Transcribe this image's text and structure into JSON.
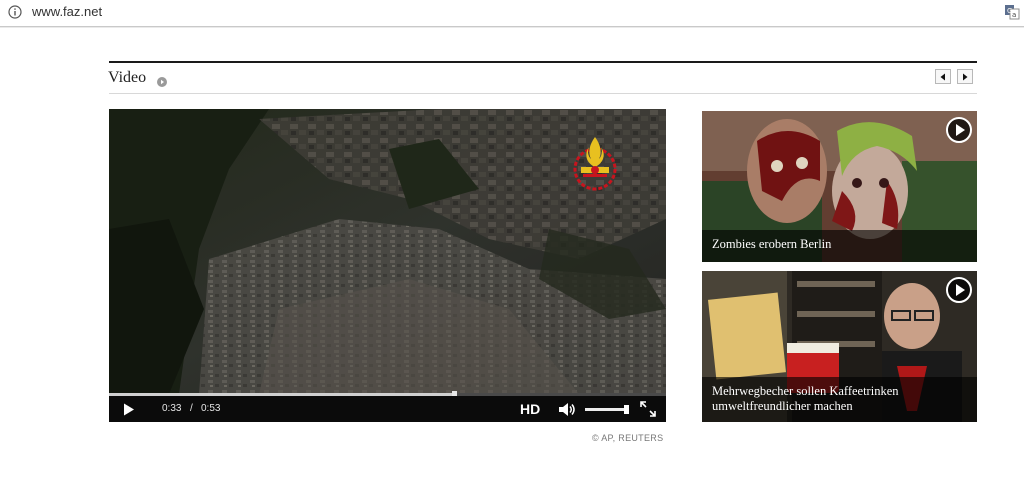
{
  "browser": {
    "url": "www.faz.net"
  },
  "section": {
    "title": "Video"
  },
  "main_video": {
    "current_time": "0:33",
    "time_separator": "/",
    "total_time": "0:53",
    "progress": 0.62,
    "hd_label": "HD",
    "volume": 1.0,
    "credit": "© AP, REUTERS"
  },
  "thumbnails": [
    {
      "caption": "Zombies erobern Berlin"
    },
    {
      "caption": "Mehrwegbecher sollen Kaffeetrinken umweltfreundlicher machen"
    }
  ],
  "colors": {
    "accent_rule": "#1a1a1a",
    "logo_red": "#c8141e",
    "logo_gold": "#e8c020"
  }
}
